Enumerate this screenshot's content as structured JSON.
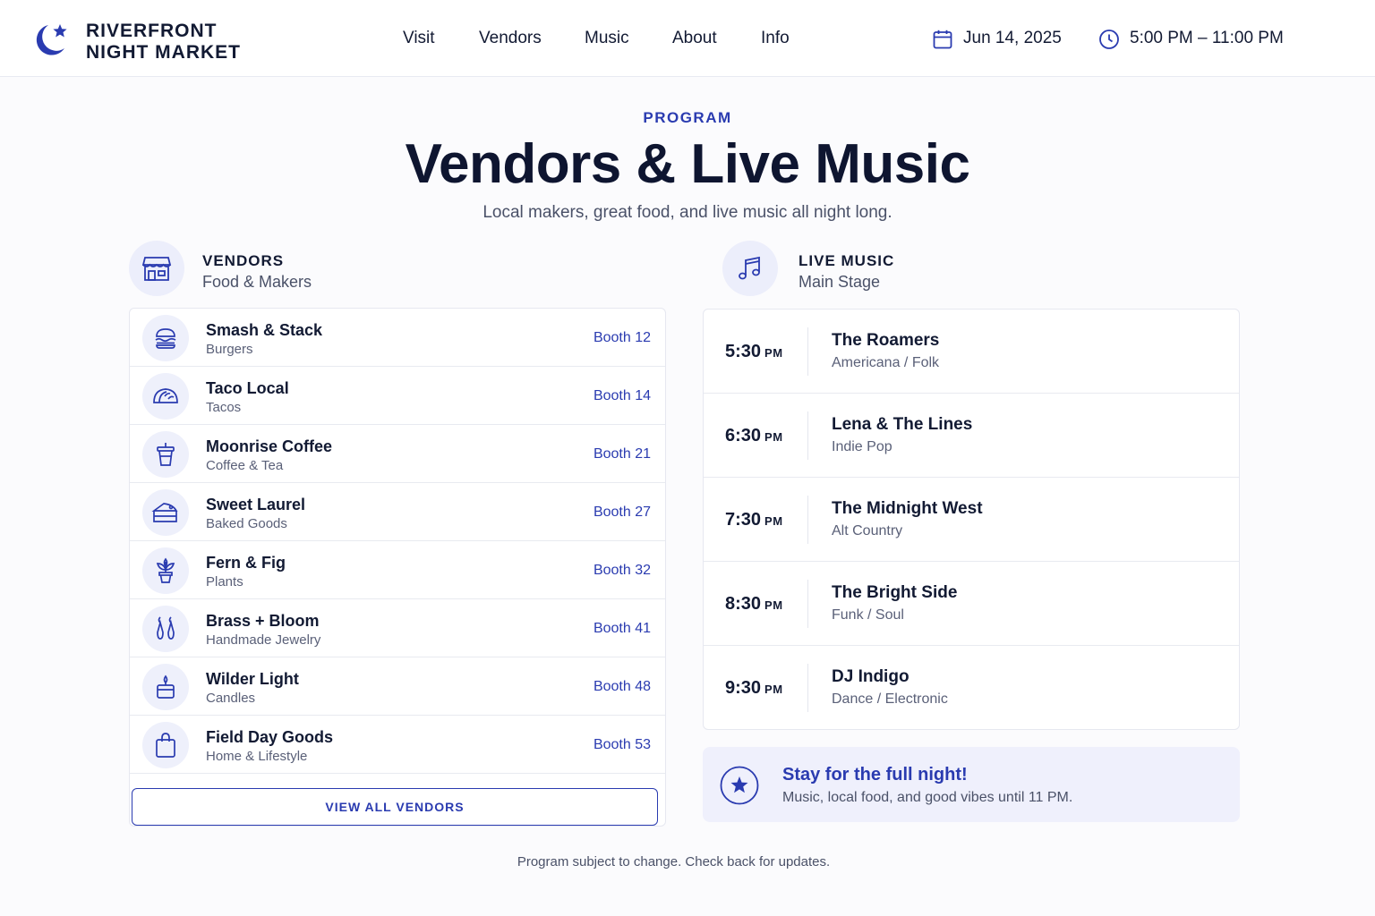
{
  "header": {
    "brand_line1": "RIVERFRONT",
    "brand_line2": "NIGHT MARKET",
    "nav": [
      "Visit",
      "Vendors",
      "Music",
      "About",
      "Info"
    ],
    "date": "Jun 14, 2025",
    "hours": "5:00 PM – 11:00 PM"
  },
  "hero": {
    "eyebrow": "PROGRAM",
    "title": "Vendors & Live Music",
    "subtitle": "Local makers, great food, and live music all night long."
  },
  "vendors_section": {
    "title": "VENDORS",
    "subtitle": "Food & Makers",
    "items": [
      {
        "name": "Smash & Stack",
        "category": "Burgers",
        "booth": "Booth 12",
        "icon": "burger-icon"
      },
      {
        "name": "Taco Local",
        "category": "Tacos",
        "booth": "Booth 14",
        "icon": "taco-icon"
      },
      {
        "name": "Moonrise Coffee",
        "category": "Coffee & Tea",
        "booth": "Booth 21",
        "icon": "coffee-cup-icon"
      },
      {
        "name": "Sweet Laurel",
        "category": "Baked Goods",
        "booth": "Booth 27",
        "icon": "cake-icon"
      },
      {
        "name": "Fern & Fig",
        "category": "Plants",
        "booth": "Booth 32",
        "icon": "plant-icon"
      },
      {
        "name": "Brass + Bloom",
        "category": "Handmade Jewelry",
        "booth": "Booth 41",
        "icon": "earrings-icon"
      },
      {
        "name": "Wilder Light",
        "category": "Candles",
        "booth": "Booth 48",
        "icon": "candle-icon"
      },
      {
        "name": "Field Day Goods",
        "category": "Home & Lifestyle",
        "booth": "Booth 53",
        "icon": "shopping-bag-icon"
      }
    ],
    "view_all_label": "VIEW ALL VENDORS"
  },
  "music_section": {
    "title": "LIVE MUSIC",
    "subtitle": "Main Stage",
    "schedule": [
      {
        "time": "5:30",
        "period": "PM",
        "artist": "The Roamers",
        "genre": "Americana / Folk"
      },
      {
        "time": "6:30",
        "period": "PM",
        "artist": "Lena & The Lines",
        "genre": "Indie Pop"
      },
      {
        "time": "7:30",
        "period": "PM",
        "artist": "The Midnight West",
        "genre": "Alt Country"
      },
      {
        "time": "8:30",
        "period": "PM",
        "artist": "The Bright Side",
        "genre": "Funk / Soul"
      },
      {
        "time": "9:30",
        "period": "PM",
        "artist": "DJ Indigo",
        "genre": "Dance / Electronic"
      }
    ]
  },
  "promo": {
    "title": "Stay for the full night!",
    "text": "Music, local food, and good vibes until 11 PM."
  },
  "footer_note": "Program subject to change. Check back for updates.",
  "colors": {
    "accent": "#2a3bb0",
    "text": "#121a33",
    "muted": "#4a5168",
    "icon_bg": "#eef0fb",
    "promo_bg": "#eff0fc"
  }
}
